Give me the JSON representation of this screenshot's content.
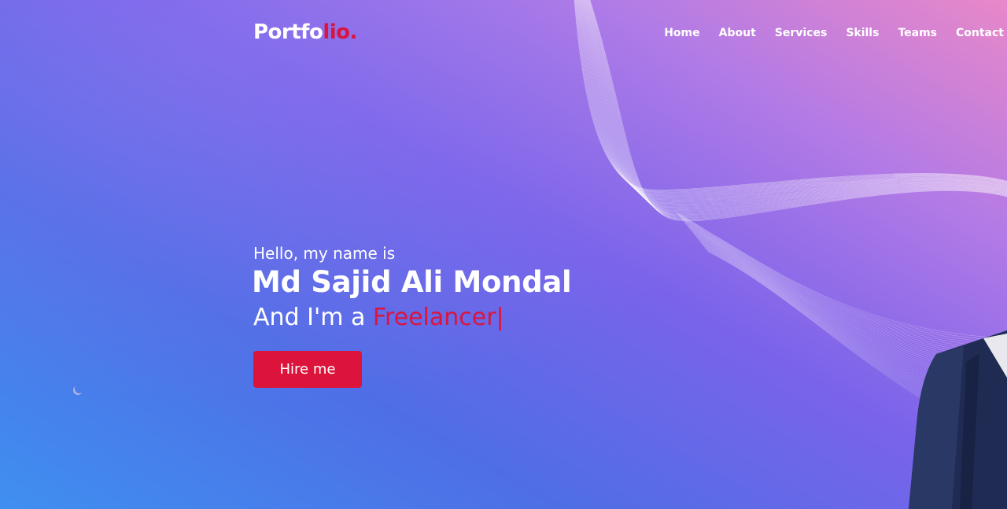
{
  "navbar": {
    "logo": {
      "main": "Portfo",
      "accent": "lio."
    },
    "menu": [
      {
        "label": "Home"
      },
      {
        "label": "About"
      },
      {
        "label": "Services"
      },
      {
        "label": "Skills"
      },
      {
        "label": "Teams"
      },
      {
        "label": "Contact"
      }
    ]
  },
  "hero": {
    "greeting": "Hello, my name is",
    "name": "Md Sajid Ali Mondal",
    "role_prefix": "And I'm a ",
    "role_typed": "Freelancer",
    "cursor": "|",
    "cta_label": "Hire me"
  },
  "colors": {
    "accent": "#dc143c",
    "text": "#ffffff",
    "gradient_start": "#3f8ff0",
    "gradient_end": "#e888c8"
  },
  "icons": {
    "decor": "crescent-moon-icon",
    "photo": "person-photo"
  }
}
